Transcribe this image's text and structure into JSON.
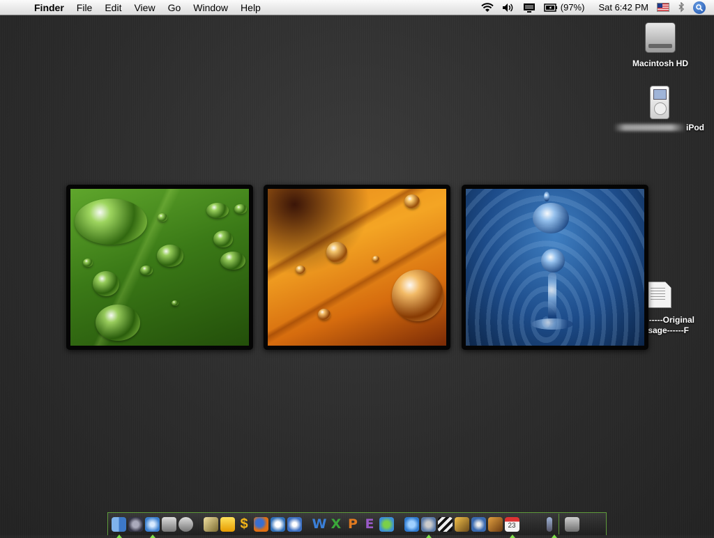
{
  "menubar": {
    "apple_icon": "apple-icon",
    "app_name": "Finder",
    "menus": [
      "File",
      "Edit",
      "View",
      "Go",
      "Window",
      "Help"
    ],
    "status": {
      "wifi_icon": "wifi-icon",
      "volume_icon": "volume-icon",
      "display_icon": "display-icon",
      "battery_icon": "battery-icon",
      "battery_percent": "(97%)",
      "clock": "Sat 6:42 PM",
      "input_flag_icon": "us-flag-icon",
      "bluetooth_icon": "bluetooth-icon",
      "spotlight_icon": "spotlight-icon"
    }
  },
  "desktop": {
    "hard_drive_label": "Macintosh HD",
    "ipod_label": "iPod",
    "document_label_line1": "-----Original",
    "document_label_line2": "Message------F"
  },
  "dock": {
    "left_items": [
      "finder-icon",
      "dashboard-icon",
      "safari-icon",
      "itunes-paint-icon",
      "microscope-icon",
      "pencil-icon",
      "checklist-icon",
      "dollar-icon",
      "firefox-icon",
      "mail-icon",
      "compass-icon",
      "w-icon",
      "x-icon",
      "p-icon",
      "e-icon",
      "msn-icon",
      "ichat-icon",
      "itunes-icon",
      "imovie-icon",
      "iphoto-icon",
      "dvd-icon",
      "garageband-icon",
      "ical-icon",
      "ipod-dock-icon"
    ],
    "ical_date": "23",
    "letters": {
      "w": "W",
      "x": "X",
      "p": "P",
      "e": "E"
    },
    "trash_icon": "trash-icon",
    "accent_color": "#7fe04a"
  }
}
